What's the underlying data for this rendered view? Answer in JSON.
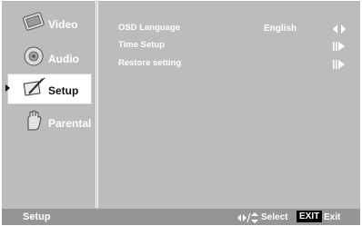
{
  "sidebar": {
    "items": [
      {
        "label": "Video",
        "icon": "video-icon"
      },
      {
        "label": "Audio",
        "icon": "audio-icon"
      },
      {
        "label": "Setup",
        "icon": "setup-icon",
        "selected": true
      },
      {
        "label": "Parental",
        "icon": "parental-icon"
      }
    ]
  },
  "menu": {
    "rows": [
      {
        "label": "OSD Language",
        "value": "English",
        "nav": "left-right-arrows-icon"
      },
      {
        "label": "Time Setup",
        "value": "",
        "nav": "enter-arrow-icon"
      },
      {
        "label": "Restore setting",
        "value": "",
        "nav": "enter-arrow-icon"
      }
    ]
  },
  "footer": {
    "title": "Setup",
    "select_label": "Select",
    "exit_key": "EXIT",
    "exit_label": "Exit"
  },
  "colors": {
    "panel_bg": "#bdbcba",
    "footer_bg": "#959593",
    "text": "#ffffff",
    "selected_bg": "#ffffff"
  }
}
